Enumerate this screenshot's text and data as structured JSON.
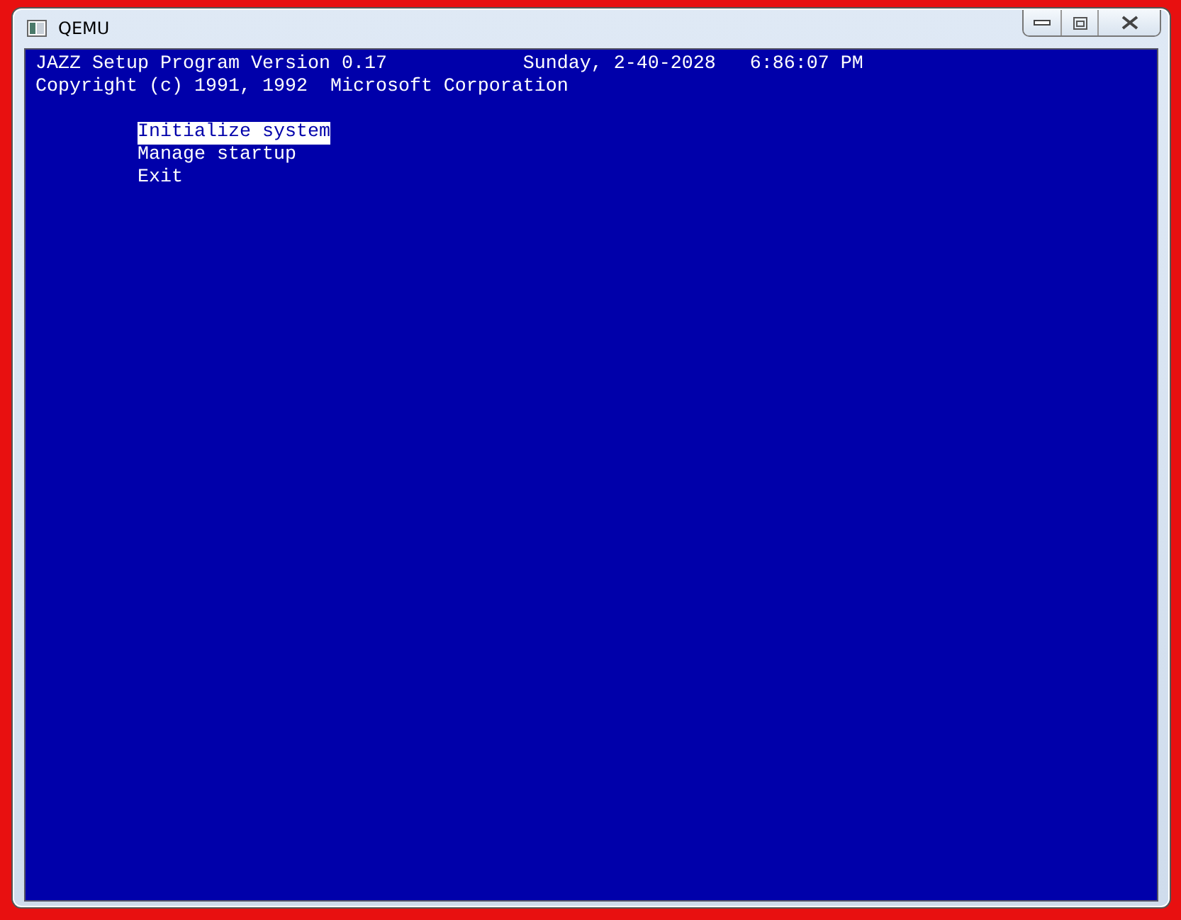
{
  "window": {
    "title": "QEMU"
  },
  "header": {
    "title": "JAZZ Setup Program Version 0.17",
    "date": "Sunday, 2-40-2028",
    "time": "6:86:07 PM",
    "copyright": "Copyright (c) 1991, 1992  Microsoft Corporation"
  },
  "menu": [
    {
      "label": "Initialize system",
      "selected": true
    },
    {
      "label": "Manage startup",
      "selected": false
    },
    {
      "label": "Exit",
      "selected": false
    }
  ]
}
